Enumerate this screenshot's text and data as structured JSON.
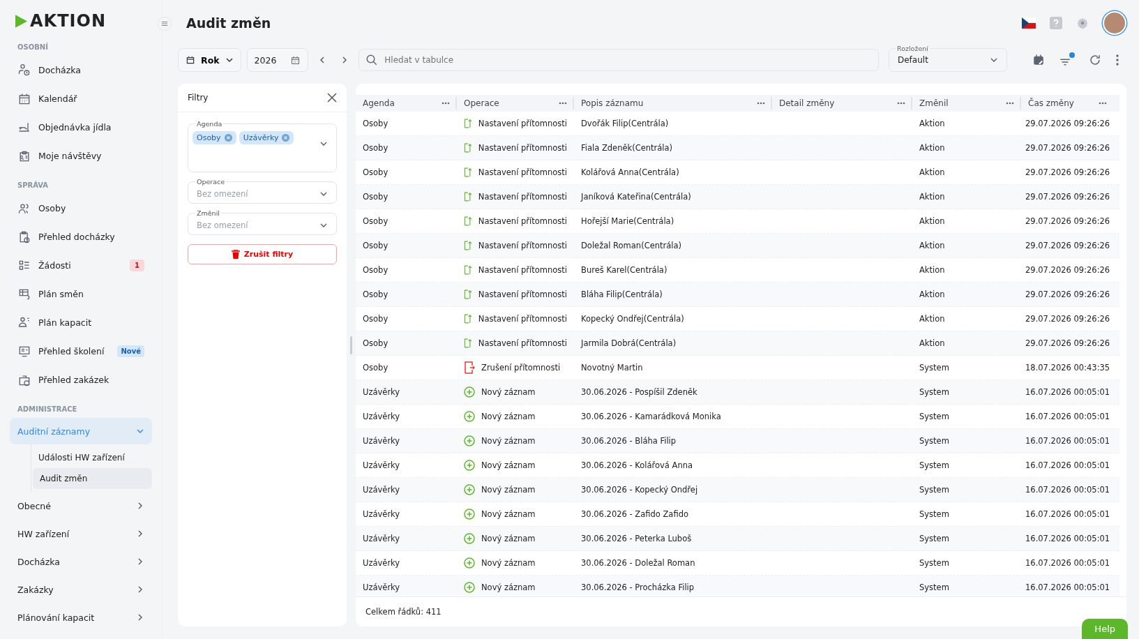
{
  "logo": "AKTION",
  "sidebar": {
    "sections": [
      {
        "title": "OSOBNÍ",
        "items": [
          {
            "label": "Docházka"
          },
          {
            "label": "Kalendář"
          },
          {
            "label": "Objednávka jídla"
          },
          {
            "label": "Moje návštěvy"
          }
        ]
      },
      {
        "title": "SPRÁVA",
        "items": [
          {
            "label": "Osoby"
          },
          {
            "label": "Přehled docházky"
          },
          {
            "label": "Žádosti",
            "badge": {
              "text": "1",
              "kind": "alert"
            }
          },
          {
            "label": "Plán směn"
          },
          {
            "label": "Plán kapacit"
          },
          {
            "label": "Přehled školení",
            "badge": {
              "text": "Nové",
              "kind": "new"
            }
          },
          {
            "label": "Přehled zakázek"
          }
        ]
      },
      {
        "title": "ADMINISTRACE",
        "groups": [
          {
            "label": "Auditní záznamy",
            "expanded": true,
            "children": [
              {
                "label": "Události HW zařízení",
                "selected": false
              },
              {
                "label": "Audit změn",
                "selected": true
              }
            ]
          },
          {
            "label": "Obecné",
            "expanded": false
          },
          {
            "label": "HW zařízení",
            "expanded": false
          },
          {
            "label": "Docházka",
            "expanded": false
          },
          {
            "label": "Zakázky",
            "expanded": false
          },
          {
            "label": "Plánování kapacit",
            "expanded": false
          }
        ]
      }
    ]
  },
  "page": {
    "title": "Audit změn"
  },
  "toolbar": {
    "period": "Rok",
    "year": "2026",
    "search": {
      "placeholder": "Hledat v tabulce"
    },
    "layout": {
      "label": "Rozložení",
      "value": "Default"
    },
    "filter_active": true
  },
  "filters": {
    "title": "Filtry",
    "fields": [
      {
        "label": "Agenda",
        "chips": [
          "Osoby",
          "Uzávěrky"
        ]
      },
      {
        "label": "Operace",
        "placeholder": "Bez omezení"
      },
      {
        "label": "Změnil",
        "placeholder": "Bez omezení"
      }
    ],
    "clear_button": "Zrušit filtry"
  },
  "table": {
    "columns": [
      "Agenda",
      "Operace",
      "Popis záznamu",
      "Detail změny",
      "Změnil",
      "Čas změny"
    ],
    "rows": [
      {
        "agenda": "Osoby",
        "kind": "set",
        "operation": "Nastavení přítomnosti",
        "description": "Dvořák Filip(Centrála)",
        "changed_by": "Aktion",
        "time": "29.07.2026 09:26:26"
      },
      {
        "agenda": "Osoby",
        "kind": "set",
        "operation": "Nastavení přítomnosti",
        "description": "Fiala Zdeněk(Centrála)",
        "changed_by": "Aktion",
        "time": "29.07.2026 09:26:26"
      },
      {
        "agenda": "Osoby",
        "kind": "set",
        "operation": "Nastavení přítomnosti",
        "description": "Kolářová Anna(Centrála)",
        "changed_by": "Aktion",
        "time": "29.07.2026 09:26:26"
      },
      {
        "agenda": "Osoby",
        "kind": "set",
        "operation": "Nastavení přítomnosti",
        "description": "Janíková Kateřina(Centrála)",
        "changed_by": "Aktion",
        "time": "29.07.2026 09:26:26"
      },
      {
        "agenda": "Osoby",
        "kind": "set",
        "operation": "Nastavení přítomnosti",
        "description": "Hořejší Marie(Centrála)",
        "changed_by": "Aktion",
        "time": "29.07.2026 09:26:26"
      },
      {
        "agenda": "Osoby",
        "kind": "set",
        "operation": "Nastavení přítomnosti",
        "description": "Doležal Roman(Centrála)",
        "changed_by": "Aktion",
        "time": "29.07.2026 09:26:26"
      },
      {
        "agenda": "Osoby",
        "kind": "set",
        "operation": "Nastavení přítomnosti",
        "description": "Bureš Karel(Centrála)",
        "changed_by": "Aktion",
        "time": "29.07.2026 09:26:26"
      },
      {
        "agenda": "Osoby",
        "kind": "set",
        "operation": "Nastavení přítomnosti",
        "description": "Bláha Filip(Centrála)",
        "changed_by": "Aktion",
        "time": "29.07.2026 09:26:26"
      },
      {
        "agenda": "Osoby",
        "kind": "set",
        "operation": "Nastavení přítomnosti",
        "description": "Kopecký Ondřej(Centrála)",
        "changed_by": "Aktion",
        "time": "29.07.2026 09:26:26"
      },
      {
        "agenda": "Osoby",
        "kind": "set",
        "operation": "Nastavení přítomnosti",
        "description": "Jarmila Dobrá(Centrála)",
        "changed_by": "Aktion",
        "time": "29.07.2026 09:26:26"
      },
      {
        "agenda": "Osoby",
        "kind": "cancel",
        "operation": "Zrušení přítomnosti",
        "description": "Novotný Martin",
        "changed_by": "System",
        "time": "18.07.2026 00:43:35"
      },
      {
        "agenda": "Uzávěrky",
        "kind": "new",
        "operation": "Nový záznam",
        "description": "30.06.2026 - Pospíšil Zdeněk",
        "changed_by": "System",
        "time": "16.07.2026 00:05:01"
      },
      {
        "agenda": "Uzávěrky",
        "kind": "new",
        "operation": "Nový záznam",
        "description": "30.06.2026 - Kamarádková Monika",
        "changed_by": "System",
        "time": "16.07.2026 00:05:01"
      },
      {
        "agenda": "Uzávěrky",
        "kind": "new",
        "operation": "Nový záznam",
        "description": "30.06.2026 - Bláha Filip",
        "changed_by": "System",
        "time": "16.07.2026 00:05:01"
      },
      {
        "agenda": "Uzávěrky",
        "kind": "new",
        "operation": "Nový záznam",
        "description": "30.06.2026 - Kolářová Anna",
        "changed_by": "System",
        "time": "16.07.2026 00:05:01"
      },
      {
        "agenda": "Uzávěrky",
        "kind": "new",
        "operation": "Nový záznam",
        "description": "30.06.2026 - Kopecký Ondřej",
        "changed_by": "System",
        "time": "16.07.2026 00:05:01"
      },
      {
        "agenda": "Uzávěrky",
        "kind": "new",
        "operation": "Nový záznam",
        "description": "30.06.2026 - Zafido Zafido",
        "changed_by": "System",
        "time": "16.07.2026 00:05:01"
      },
      {
        "agenda": "Uzávěrky",
        "kind": "new",
        "operation": "Nový záznam",
        "description": "30.06.2026 - Peterka Luboš",
        "changed_by": "System",
        "time": "16.07.2026 00:05:01"
      },
      {
        "agenda": "Uzávěrky",
        "kind": "new",
        "operation": "Nový záznam",
        "description": "30.06.2026 - Doležal Roman",
        "changed_by": "System",
        "time": "16.07.2026 00:05:01"
      },
      {
        "agenda": "Uzávěrky",
        "kind": "new",
        "operation": "Nový záznam",
        "description": "30.06.2026 - Procházka Filip",
        "changed_by": "System",
        "time": "16.07.2026 00:05:01"
      }
    ],
    "footer": "Celkem řádků: 411"
  },
  "help_button": "Help"
}
